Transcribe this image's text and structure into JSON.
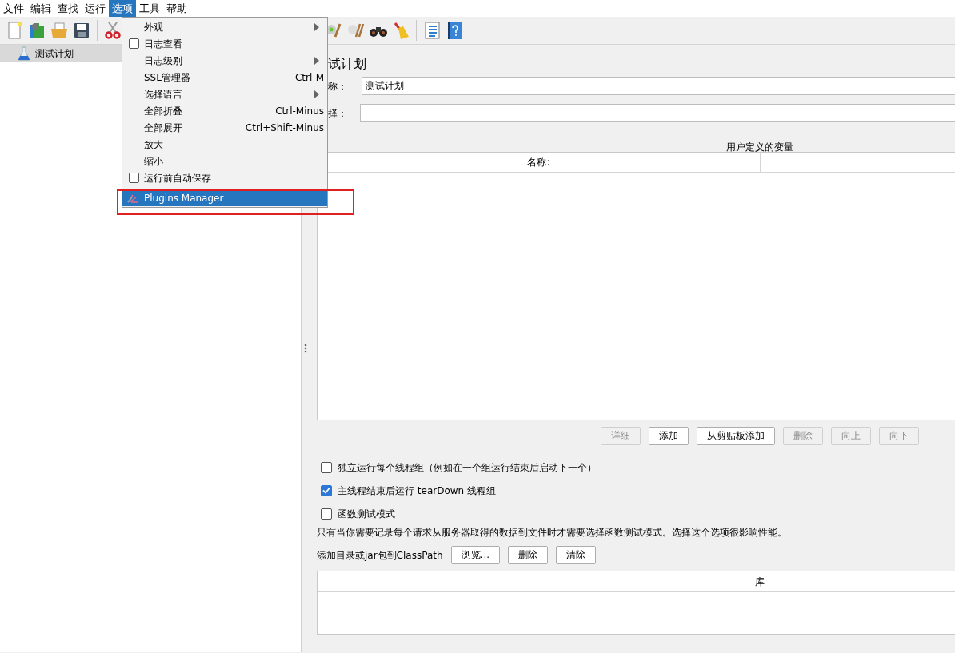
{
  "menubar": [
    {
      "label": "文件",
      "selected": false
    },
    {
      "label": "编辑",
      "selected": false
    },
    {
      "label": "查找",
      "selected": false
    },
    {
      "label": "运行",
      "selected": false
    },
    {
      "label": "选项",
      "selected": true
    },
    {
      "label": "工具",
      "selected": false
    },
    {
      "label": "帮助",
      "selected": false
    }
  ],
  "toolbar_left": [
    {
      "kind": "new"
    },
    {
      "kind": "templates"
    },
    {
      "kind": "open"
    },
    {
      "kind": "save"
    },
    {
      "kind": "sep"
    },
    {
      "kind": "cut"
    }
  ],
  "toolbar_right": [
    {
      "kind": "clear"
    },
    {
      "kind": "clearall"
    },
    {
      "kind": "search"
    },
    {
      "kind": "broom"
    },
    {
      "kind": "sep"
    },
    {
      "kind": "list"
    },
    {
      "kind": "help"
    }
  ],
  "tree": [
    {
      "label": "测试计划",
      "selected": true
    }
  ],
  "menu": [
    {
      "kind": "submenu",
      "label": "外观"
    },
    {
      "kind": "check",
      "label": "日志查看",
      "checked": false
    },
    {
      "kind": "submenu",
      "label": "日志级别"
    },
    {
      "kind": "plain",
      "label": "SSL管理器",
      "shortcut": "Ctrl-M"
    },
    {
      "kind": "submenu",
      "label": "选择语言"
    },
    {
      "kind": "plain",
      "label": "全部折叠",
      "shortcut": "Ctrl-Minus"
    },
    {
      "kind": "plain",
      "label": "全部展开",
      "shortcut": "Ctrl+Shift-Minus"
    },
    {
      "kind": "plain",
      "label": "放大"
    },
    {
      "kind": "plain",
      "label": "缩小"
    },
    {
      "kind": "check",
      "label": "运行前自动保存",
      "checked": false
    },
    {
      "kind": "plugin",
      "label": "Plugins Manager",
      "selected": true,
      "annotated": true
    }
  ],
  "panel": {
    "title": "试计划",
    "name_label": "称：",
    "name_value": "测试计划",
    "comment_label": "择：",
    "variables": {
      "title": "用户定义的变量",
      "columns": [
        "名称:"
      ]
    },
    "buttons": [
      {
        "label": "详细",
        "disabled": true
      },
      {
        "label": "添加",
        "disabled": false
      },
      {
        "label": "从剪贴板添加",
        "disabled": false
      },
      {
        "label": "删除",
        "disabled": true
      },
      {
        "label": "向上",
        "disabled": true
      },
      {
        "label": "向下",
        "disabled": true
      }
    ],
    "options": [
      {
        "label": "独立运行每个线程组（例如在一个组运行结束后启动下一个）",
        "checked": false
      },
      {
        "label": "主线程结束后运行 tearDown 线程组",
        "checked": true
      },
      {
        "label": "函数测试模式",
        "checked": false
      }
    ],
    "note": "只有当你需要记录每个请求从服务器取得的数据到文件时才需要选择函数测试模式。选择这个选项很影响性能。",
    "classpath_label": "添加目录或jar包到ClassPath",
    "classpath_buttons": [
      "浏览...",
      "删除",
      "清除"
    ],
    "library": {
      "columns": [
        "库"
      ]
    }
  }
}
